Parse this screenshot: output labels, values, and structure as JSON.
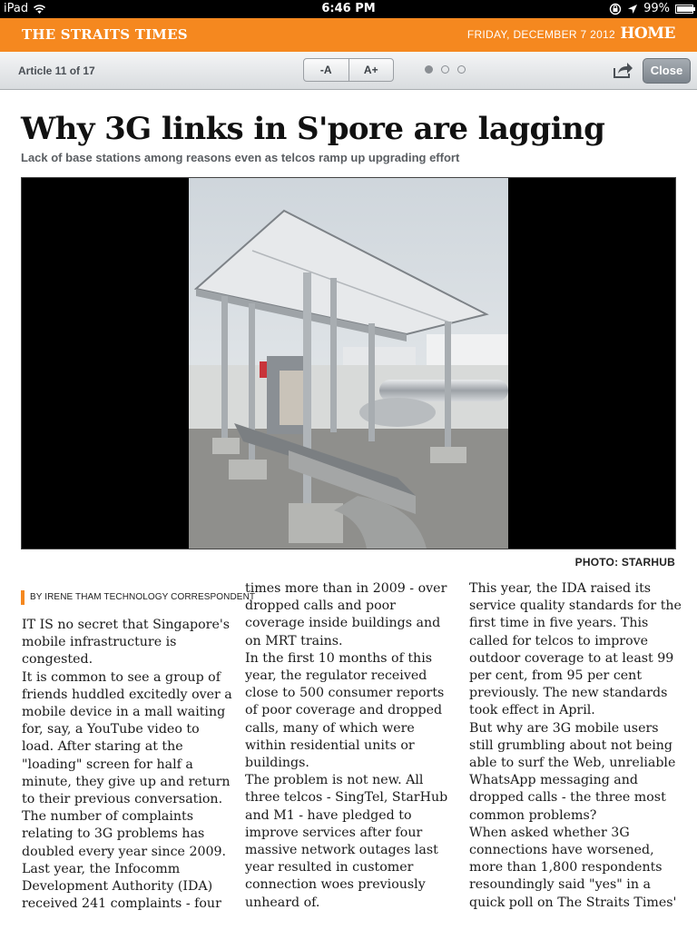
{
  "statusbar": {
    "device": "iPad",
    "time": "6:46 PM",
    "battery": "99%"
  },
  "masthead": {
    "paper": "THE STRAITS TIMES",
    "date": "FRIDAY, DECEMBER 7 2012",
    "home": "HOME"
  },
  "toolbar": {
    "article_count": "Article 11 of 17",
    "font_smaller": "-A",
    "font_larger": "A+",
    "close": "Close",
    "page_dots": {
      "total": 3,
      "current": 1
    }
  },
  "article": {
    "headline": "Why 3G links in S'pore are lagging",
    "subhead": "Lack of base stations among reasons even as telcos ramp up upgrading effort",
    "photo_credit": "PHOTO: STARHUB",
    "byline": "BY IRENE THAM TECHNOLOGY CORRESPONDENT",
    "columns": [
      [
        "IT IS no secret that Singapore's",
        "mobile infrastructure is",
        "congested.",
        " It is common to see a group of",
        "friends huddled excitedly over a",
        "mobile device in a mall waiting",
        "for, say, a YouTube video to",
        "load. After staring at the",
        "\"loading\" screen for half a",
        "minute, they give up and return",
        "to their previous conversation.",
        " The number of complaints",
        "relating to 3G problems has",
        "doubled every year since 2009.",
        " Last year, the Infocomm",
        "Development Authority (IDA)",
        "received 241 complaints - four"
      ],
      [
        "times more than in 2009 - over",
        "dropped calls and poor",
        "coverage inside buildings and",
        "on MRT trains.",
        " In the first 10 months of this",
        "year, the regulator received",
        "close to 500 consumer reports",
        "of poor coverage and dropped",
        "calls, many of which were",
        "within residential units or",
        "buildings.",
        " The problem is not new. All",
        "three telcos - SingTel, StarHub",
        "and M1 - have pledged to",
        "improve services after four",
        "massive network outages last",
        "year resulted in customer",
        "connection woes previously",
        "unheard of."
      ],
      [
        " This year, the IDA raised its",
        "service quality standards for the",
        "first time in five years. This",
        "called for telcos to improve",
        "outdoor coverage to at least 99",
        "per cent, from 95 per cent",
        "previously. The new standards",
        "took effect in April.",
        " But why are 3G mobile users",
        "still grumbling about not being",
        "able to surf the Web, unreliable",
        "WhatsApp messaging and",
        "dropped calls - the three most",
        "common problems?",
        " When asked whether 3G",
        "connections have worsened,",
        "more than 1,800 respondents",
        "resoundingly said \"yes\" in a",
        "quick poll on The Straits Times'"
      ]
    ]
  },
  "colors": {
    "masthead": "#f5881f",
    "accent": "#f5881f"
  },
  "icons": [
    "wifi-icon",
    "location-arrow-icon",
    "rotation-lock-icon",
    "battery-icon",
    "share-icon"
  ]
}
